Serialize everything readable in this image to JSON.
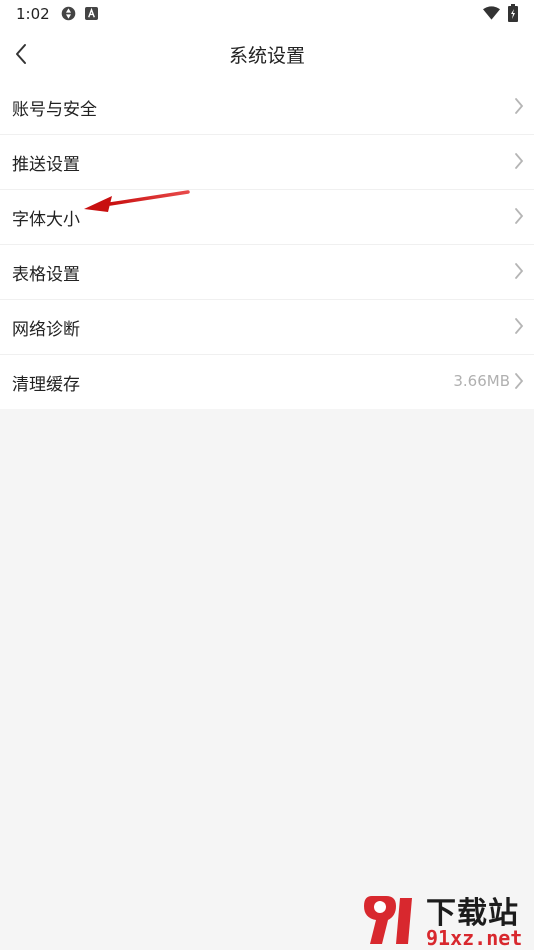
{
  "status_bar": {
    "time": "1:02",
    "icons": [
      "sync-icon",
      "font-icon",
      "wifi-icon",
      "battery-charging-icon"
    ]
  },
  "header": {
    "title": "系统设置",
    "back_icon": "chevron-left-icon"
  },
  "settings": {
    "items": [
      {
        "label": "账号与安全",
        "value": ""
      },
      {
        "label": "推送设置",
        "value": ""
      },
      {
        "label": "字体大小",
        "value": ""
      },
      {
        "label": "表格设置",
        "value": ""
      },
      {
        "label": "网络诊断",
        "value": ""
      },
      {
        "label": "清理缓存",
        "value": "3.66MB"
      }
    ]
  },
  "annotation": {
    "type": "arrow",
    "color": "#d61b1b",
    "target": "字体大小"
  },
  "watermark": {
    "title": "下载站",
    "url": "91xz.net",
    "color": "#d8282e"
  },
  "colors": {
    "background": "#f5f5f5",
    "surface": "#ffffff",
    "text": "#222222",
    "secondary_text": "#b0b0b0"
  }
}
